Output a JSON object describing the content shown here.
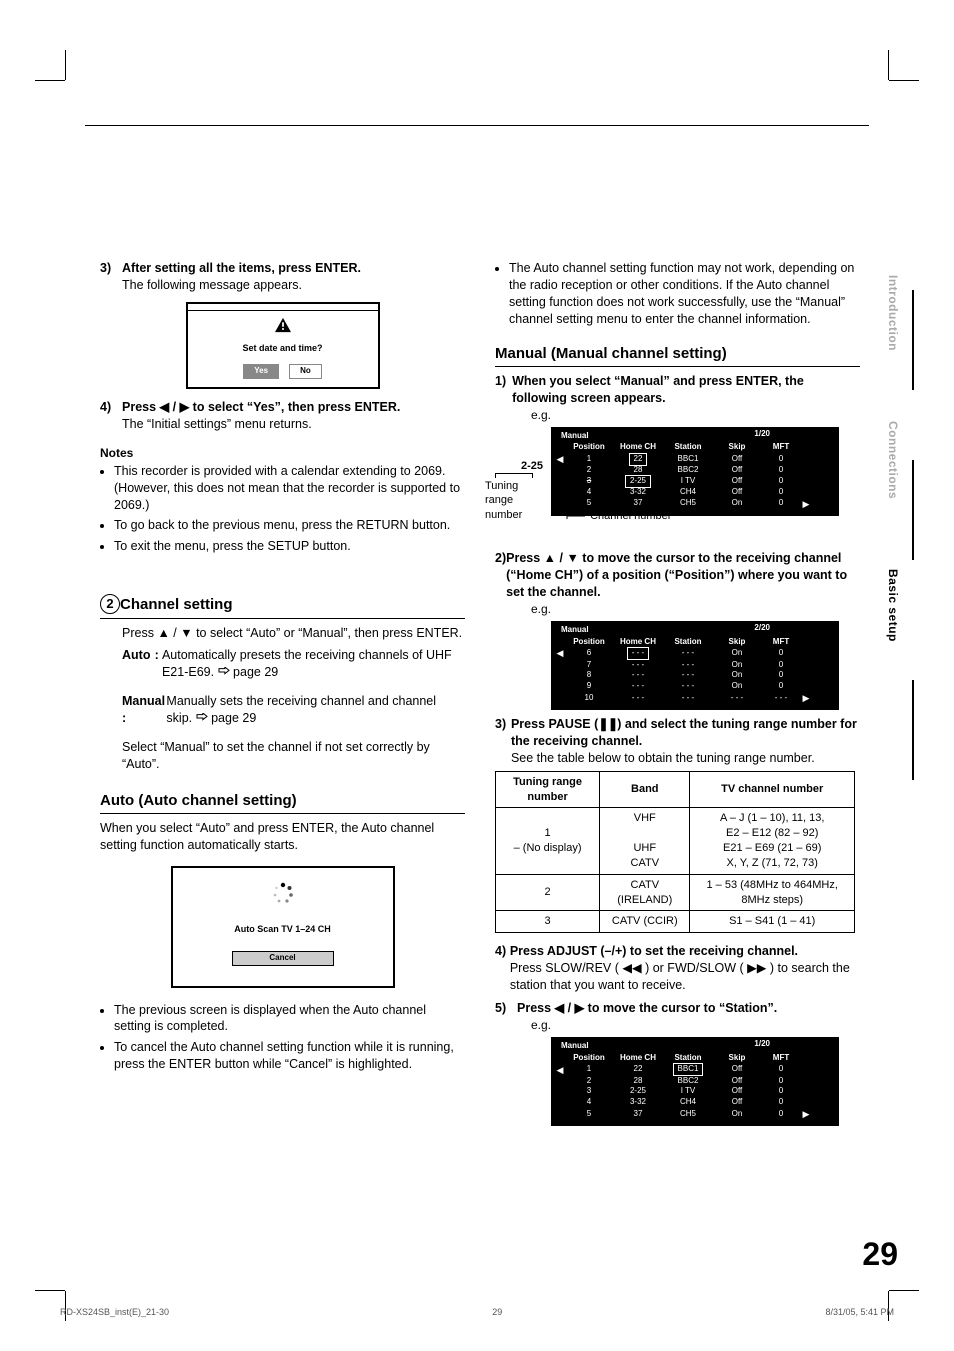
{
  "crop": {},
  "side_tabs": [
    "Introduction",
    "Connections",
    "Basic setup"
  ],
  "page_number": "29",
  "footer": {
    "file": "RD-XS24SB_inst(E)_21-30",
    "page": "29",
    "timestamp": "8/31/05, 5:41 PM"
  },
  "left": {
    "step3": {
      "num": "3)",
      "title": "After setting all the items, press ENTER.",
      "body": "The following message appears."
    },
    "dialog": {
      "msg": "Set date and time?",
      "yes": "Yes",
      "no": "No"
    },
    "step4": {
      "num": "4)",
      "title_a": "Press ",
      "title_b": " to select “Yes”, then press ENTER.",
      "body": "The “Initial settings” menu returns."
    },
    "notes_head": "Notes",
    "notes": [
      "This recorder is provided with a calendar extending to 2069. (However, this does not mean that the recorder is supported to 2069.)",
      "To go back to the previous menu, press the RETURN button.",
      "To exit the menu, press the SETUP button."
    ],
    "circle_num": "2",
    "channel_setting": "Channel setting",
    "channel_setting_body_a": "Press ",
    "channel_setting_body_b": " to select “Auto” or “Manual”, then press ENTER.",
    "auto_label": "Auto",
    "auto_colon": ":",
    "auto_desc_a": "Automatically presets the receiving channels of UHF E21-E69. ",
    "auto_desc_b": " page 29",
    "manual_label": "Manual :",
    "manual_desc_a": "Manually sets the receiving channel and channel skip. ",
    "manual_desc_b": " page 29",
    "select_manual": "Select “Manual” to set the channel if not set correctly by “Auto”.",
    "auto_head": "Auto (Auto channel setting)",
    "auto_body": "When you select “Auto” and press ENTER, the Auto channel setting function automatically starts.",
    "auto_scan_label": "Auto Scan TV 1–24 CH",
    "auto_cancel": "Cancel",
    "auto_bullets": [
      "The previous screen is displayed when the Auto channel setting is completed.",
      "To cancel the Auto channel setting function while it is running, press the ENTER button while “Cancel” is highlighted."
    ]
  },
  "right": {
    "top_bullet": "The Auto channel setting function may not work, depending on the radio reception or other conditions. If the Auto channel setting function does not work successfully, use the “Manual” channel setting menu to enter the channel information.",
    "manual_head": "Manual (Manual channel setting)",
    "step1": {
      "num": "1)",
      "title": "When you select “Manual” and press ENTER, the following screen appears."
    },
    "eg": "e.g.",
    "osd1": {
      "title": "Manual",
      "page": "1/20",
      "headers": [
        "Position",
        "Home CH",
        "Station",
        "Skip",
        "MFT"
      ],
      "rows": [
        [
          "1",
          "22",
          "BBC1",
          "Off",
          "0"
        ],
        [
          "2",
          "28",
          "BBC2",
          "Off",
          "0"
        ],
        [
          "3",
          "2-25",
          "I TV",
          "Off",
          "0"
        ],
        [
          "4",
          "3-32",
          "CH4",
          "Off",
          "0"
        ],
        [
          "5",
          "37",
          "CH5",
          "On",
          "0"
        ]
      ],
      "highlight_row": 0,
      "callout_ch": "2-25",
      "callout_trn": "Tuning range number",
      "callout_chn": "Channel number"
    },
    "step2": {
      "num": "2)",
      "title_a": "Press ",
      "title_b": " to move the cursor to the receiving channel (“Home CH”) of a position (“Position”) where you want to set the channel."
    },
    "osd2": {
      "title": "Manual",
      "page": "2/20",
      "headers": [
        "Position",
        "Home CH",
        "Station",
        "Skip",
        "MFT"
      ],
      "rows": [
        [
          "6",
          "- - -",
          "- - -",
          "On",
          "0"
        ],
        [
          "7",
          "- - -",
          "- - -",
          "On",
          "0"
        ],
        [
          "8",
          "- - -",
          "- - -",
          "On",
          "0"
        ],
        [
          "9",
          "- - -",
          "- - -",
          "On",
          "0"
        ],
        [
          "10",
          "- - -",
          "- - -",
          "- - -",
          "- - -"
        ]
      ],
      "highlight_row": 0
    },
    "step3": {
      "num": "3)",
      "title_a": "Press PAUSE (",
      "title_b": ") and select the tuning range number for the receiving channel.",
      "body": "See the table below to obtain the tuning range number."
    },
    "tuning_table": {
      "headers": [
        "Tuning range number",
        "Band",
        "TV channel number"
      ],
      "rows": [
        {
          "num": "1",
          "num_sub": "– (No display)",
          "bands": [
            "VHF",
            "UHF",
            "CATV"
          ],
          "tv": [
            "A – J (1 – 10), 11, 13,",
            "E2 – E12 (82 – 92)",
            "E21 – E69 (21 – 69)",
            "X, Y, Z (71, 72, 73)"
          ]
        },
        {
          "num": "2",
          "band": "CATV (IRELAND)",
          "tv": "1 – 53 (48MHz to 464MHz, 8MHz steps)"
        },
        {
          "num": "3",
          "band": "CATV (CCIR)",
          "tv": "S1 – S41 (1 – 41)"
        }
      ]
    },
    "step4": {
      "num": "4)",
      "title": "Press ADJUST (–/+) to set the receiving channel.",
      "body_a": "Press SLOW/REV ( ",
      "body_b": " ) or FWD/SLOW ( ",
      "body_c": " ) to search the station that you want to receive."
    },
    "step5": {
      "num": "5)",
      "title_a": "Press ",
      "title_b": " to move the cursor to “Station”."
    },
    "osd3": {
      "title": "Manual",
      "page": "1/20",
      "headers": [
        "Position",
        "Home CH",
        "Station",
        "Skip",
        "MFT"
      ],
      "rows": [
        [
          "1",
          "22",
          "BBC1",
          "Off",
          "0"
        ],
        [
          "2",
          "28",
          "BBC2",
          "Off",
          "0"
        ],
        [
          "3",
          "2-25",
          "I TV",
          "Off",
          "0"
        ],
        [
          "4",
          "3-32",
          "CH4",
          "Off",
          "0"
        ],
        [
          "5",
          "37",
          "CH5",
          "On",
          "0"
        ]
      ],
      "highlight_row": 0,
      "highlight_col": "stn"
    }
  }
}
